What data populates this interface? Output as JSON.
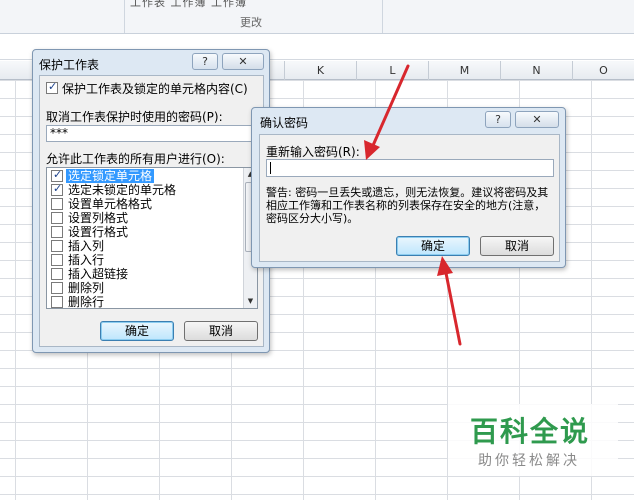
{
  "ribbon": {
    "cut_text": "工作表 工作簿 工作簿",
    "group_label": "更改"
  },
  "columns": [
    {
      "label": ""
    },
    {
      "label": ""
    },
    {
      "label": ""
    },
    {
      "label": ""
    },
    {
      "label": "K"
    },
    {
      "label": "L"
    },
    {
      "label": "M"
    },
    {
      "label": "N"
    },
    {
      "label": "O"
    }
  ],
  "protect_dialog": {
    "title": "保护工作表",
    "help_label": "?",
    "close_label": "✕",
    "protect_checkbox_label": "保护工作表及锁定的单元格内容(C)",
    "protect_checked": true,
    "password_label": "取消工作表保护时使用的密码(P):",
    "password_value": "***",
    "allow_label": "允许此工作表的所有用户进行(O):",
    "permissions": [
      {
        "label": "选定锁定单元格",
        "checked": true,
        "selected": true
      },
      {
        "label": "选定未锁定的单元格",
        "checked": true,
        "selected": false
      },
      {
        "label": "设置单元格格式",
        "checked": false,
        "selected": false
      },
      {
        "label": "设置列格式",
        "checked": false,
        "selected": false
      },
      {
        "label": "设置行格式",
        "checked": false,
        "selected": false
      },
      {
        "label": "插入列",
        "checked": false,
        "selected": false
      },
      {
        "label": "插入行",
        "checked": false,
        "selected": false
      },
      {
        "label": "插入超链接",
        "checked": false,
        "selected": false
      },
      {
        "label": "删除列",
        "checked": false,
        "selected": false
      },
      {
        "label": "删除行",
        "checked": false,
        "selected": false
      }
    ],
    "ok_label": "确定",
    "cancel_label": "取消"
  },
  "confirm_dialog": {
    "title": "确认密码",
    "help_label": "?",
    "close_label": "✕",
    "reenter_label": "重新输入密码(R):",
    "password_value": "",
    "warning": "警告: 密码一旦丢失或遗忘，则无法恢复。建议将密码及其相应工作簿和工作表名称的列表保存在安全的地方(注意，密码区分大小写)。",
    "ok_label": "确定",
    "cancel_label": "取消"
  },
  "watermark": {
    "brand": "百科全说",
    "slogan": "助你轻松解决"
  },
  "colors": {
    "arrow": "#d8272d",
    "watermark_green": "#2f9a4e",
    "selection": "#3399ff"
  }
}
